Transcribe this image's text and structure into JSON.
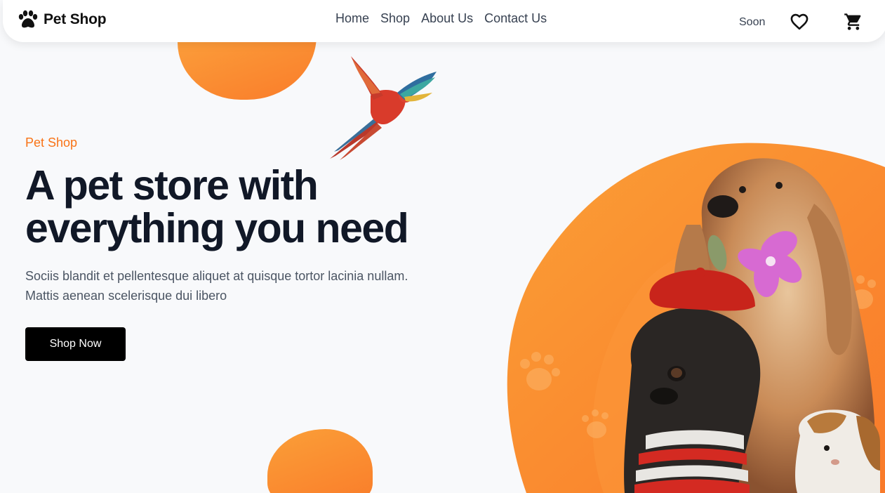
{
  "brand": {
    "name": "Pet Shop"
  },
  "nav": {
    "home": "Home",
    "shop": "Shop",
    "about": "About Us",
    "contact": "Contact Us"
  },
  "header_right": {
    "soon_label": "Soon",
    "wishlist_icon": "heart-icon",
    "cart_icon": "cart-icon"
  },
  "hero": {
    "eyebrow": "Pet Shop",
    "headline_line1": "A pet store with",
    "headline_line2": "everything you need",
    "subtext": "Sociis blandit et pellentesque aliquet at quisque tortor lacinia nullam. Mattis aenean scelerisque dui libero",
    "cta_label": "Shop Now"
  },
  "colors": {
    "accent": "#f97316",
    "text_dark": "#111827",
    "button_bg": "#000000"
  }
}
